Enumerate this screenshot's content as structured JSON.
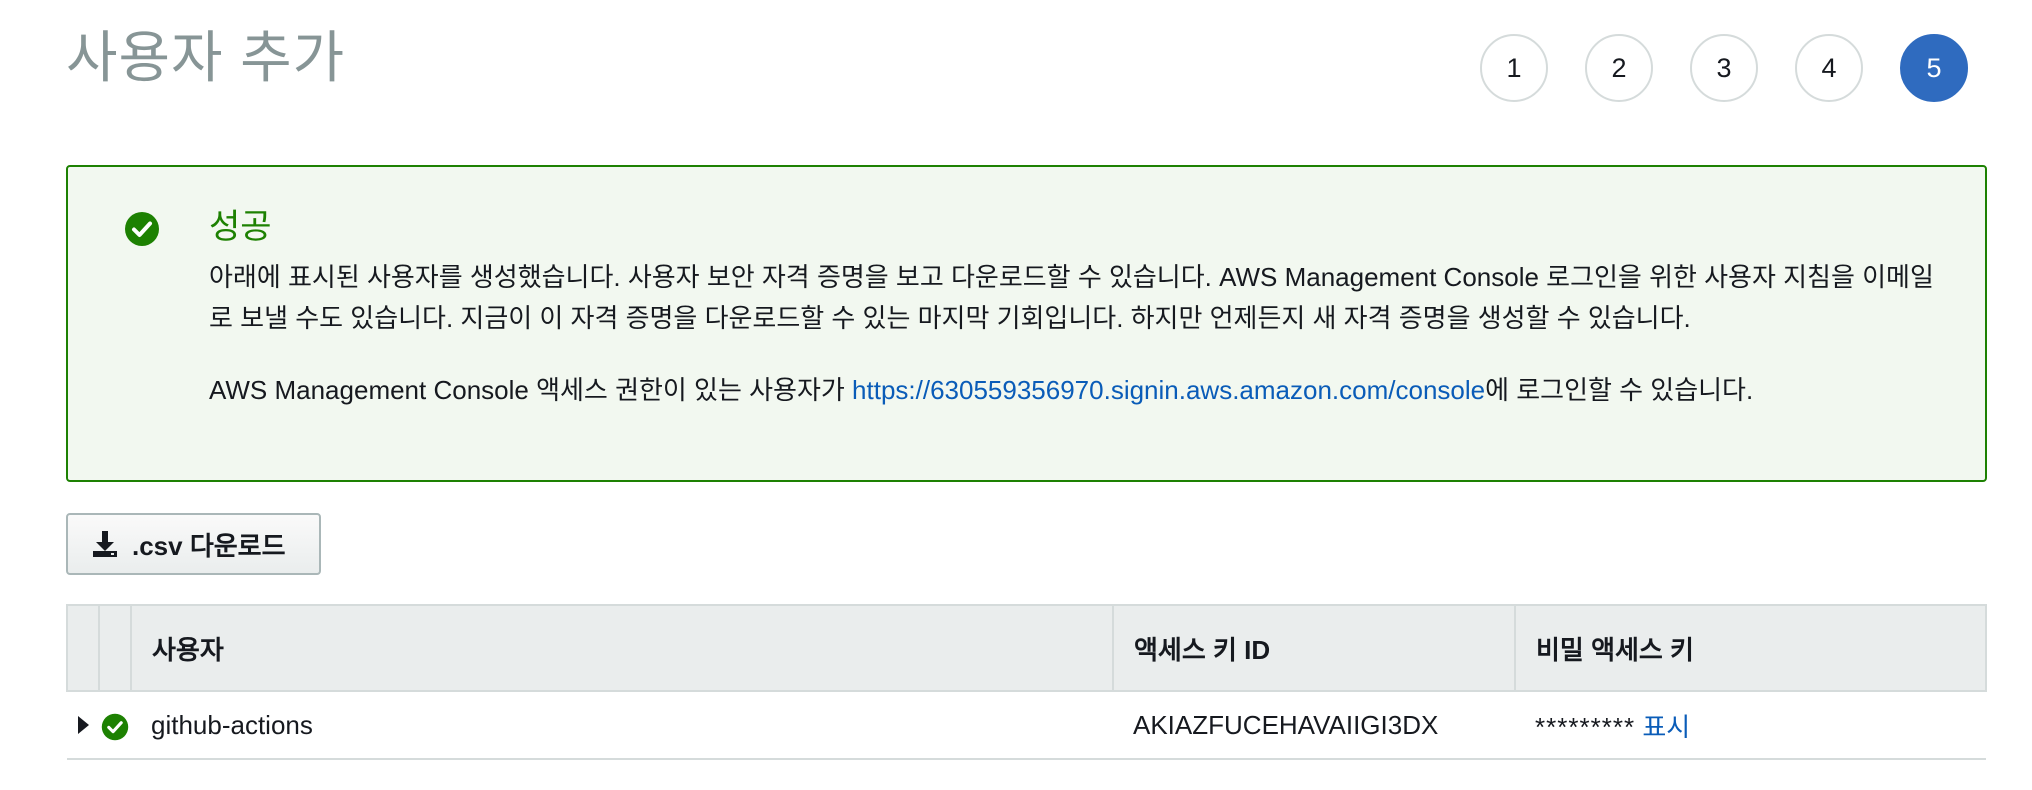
{
  "page": {
    "title": "사용자 추가"
  },
  "steps": [
    {
      "label": "1",
      "active": false
    },
    {
      "label": "2",
      "active": false
    },
    {
      "label": "3",
      "active": false
    },
    {
      "label": "4",
      "active": false
    },
    {
      "label": "5",
      "active": true
    }
  ],
  "alert": {
    "icon": "check-circle-icon",
    "title": "성공",
    "paragraph1": "아래에 표시된 사용자를 생성했습니다. 사용자 보안 자격 증명을 보고 다운로드할 수 있습니다. AWS Management Console 로그인을 위한 사용자 지침을 이메일로 보낼 수도 있습니다. 지금이 이 자격 증명을 다운로드할 수 있는 마지막 기회입니다. 하지만 언제든지 새 자격 증명을 생성할 수 있습니다.",
    "paragraph2_prefix": "AWS Management Console 액세스 권한이 있는 사용자가 ",
    "signin_link": "https://630559356970.signin.aws.amazon.com/console",
    "paragraph2_suffix": "에 로그인할 수 있습니다."
  },
  "toolbar": {
    "download_label": ".csv 다운로드",
    "download_icon": "download-icon"
  },
  "table": {
    "columns": [
      "",
      "",
      "사용자",
      "액세스 키 ID",
      "비밀 액세스 키"
    ],
    "rows": [
      {
        "user": "github-actions",
        "access_key_id": "AKIAZFUCEHAVAIIGI3DX",
        "secret_mask": "*********",
        "show_label": "표시",
        "status_icon": "check-circle-icon"
      }
    ]
  },
  "colors": {
    "success": "#1d8102",
    "accent": "#2f6bbf",
    "link": "#0a5cb8"
  }
}
